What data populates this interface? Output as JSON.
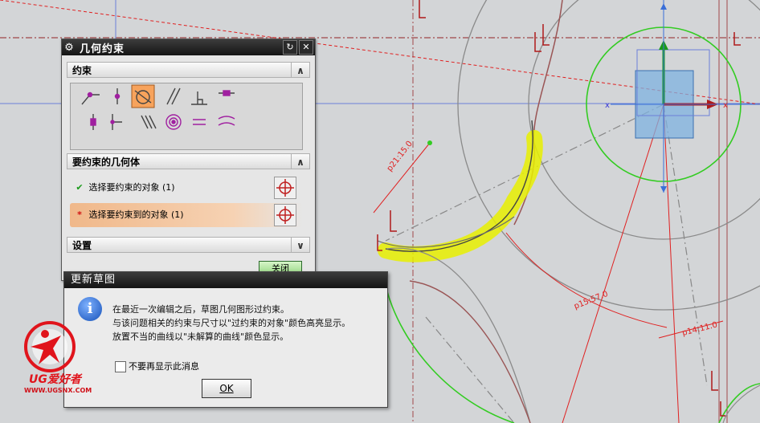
{
  "canvas": {
    "dims": [
      {
        "label": "p21:15.0",
        "aria": "dimension-p21"
      },
      {
        "label": "p15:57.0",
        "aria": "dimension-p15"
      },
      {
        "label": "p14:11.0",
        "aria": "dimension-p14"
      }
    ],
    "highlight_color": "#e8f000",
    "circle_color": "#33cc22",
    "selection_color": "#7fb1e0"
  },
  "constraint_dialog": {
    "title": "几何约束",
    "section_constraints": "约束",
    "section_geometry": "要约束的几何体",
    "row1_label": "选择要约束的对象 (1)",
    "row2_label": "选择要约束到的对象 (1)",
    "section_settings": "设置",
    "close_label": "关闭",
    "icons": [
      "coincident-icon",
      "point-on-curve-icon",
      "tangent-icon",
      "parallel-icon",
      "perpendicular-icon",
      "horizontal-icon",
      "vertical-icon",
      "midpoint-icon",
      "collinear-icon",
      "concentric-icon",
      "equal-length-icon",
      "equal-radius-icon"
    ]
  },
  "update_dialog": {
    "title": "更新草图",
    "line1": "在最近一次编辑之后，草图几何图形过约束。",
    "line2": "与该问题相关的约束与尺寸以\"过约束的对象\"颜色高亮显示。",
    "line3": "放置不当的曲线以\"未解算的曲线\"颜色显示。",
    "checkbox_label": "不要再显示此消息",
    "ok_label": "OK"
  },
  "logo": {
    "brand": "UG爱好者",
    "url": "WWW.UGSNX.COM"
  }
}
